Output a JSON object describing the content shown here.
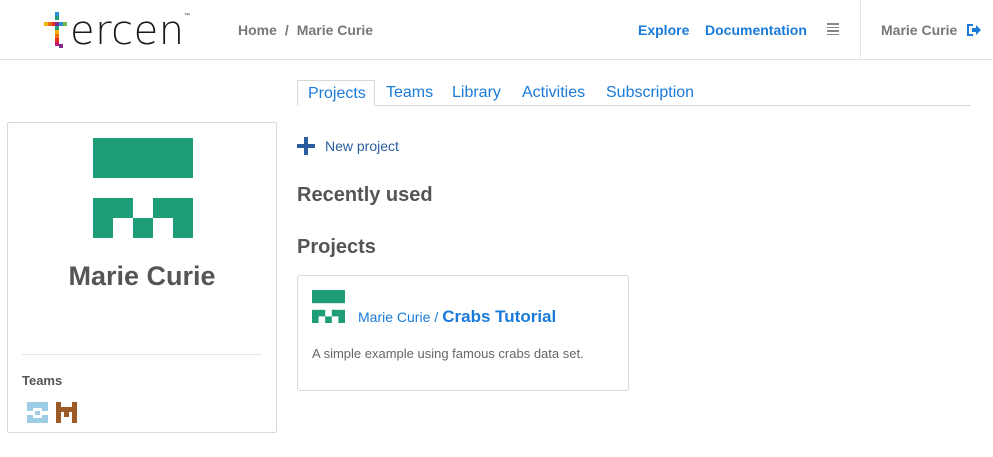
{
  "header": {
    "logo_text": "ercen",
    "logo_tm": "™",
    "breadcrumb": {
      "home": "Home",
      "separator": "/",
      "current": "Marie Curie"
    },
    "nav": {
      "explore": "Explore",
      "documentation": "Documentation"
    },
    "menu_icon": "hamburger-icon",
    "user_name": "Marie Curie",
    "logout_icon": "sign-out-icon"
  },
  "tabs": [
    {
      "label": "Projects",
      "active": true
    },
    {
      "label": "Teams",
      "active": false
    },
    {
      "label": "Library",
      "active": false
    },
    {
      "label": "Activities",
      "active": false
    },
    {
      "label": "Subscription",
      "active": false
    }
  ],
  "profile": {
    "name": "Marie Curie",
    "teams_label": "Teams",
    "avatar_color": "#1e9e78",
    "team_colors": [
      "#9dcde4",
      "#9b5a26"
    ]
  },
  "main": {
    "new_project_label": "New project",
    "recently_used_title": "Recently used",
    "projects_title": "Projects",
    "projects": [
      {
        "owner": "Marie Curie",
        "separator": "/",
        "name": "Crabs Tutorial",
        "description": "A simple example using famous crabs data set."
      }
    ]
  },
  "colors": {
    "link": "#1a7ad9",
    "text": "#555555",
    "brand_green": "#1e9e78"
  }
}
